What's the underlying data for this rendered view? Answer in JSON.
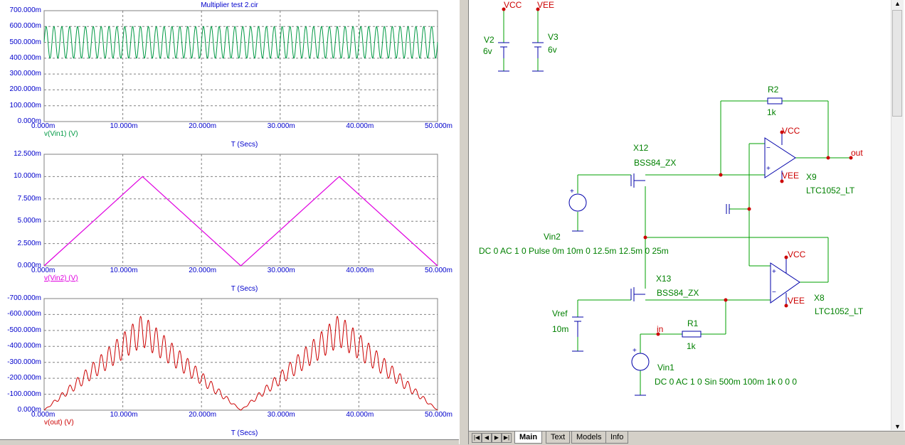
{
  "plot": {
    "title": "Multiplier test 2.cir",
    "x_ticks": [
      "0.000m",
      "10.000m",
      "20.000m",
      "30.000m",
      "40.000m",
      "50.000m"
    ],
    "x_label": "T (Secs)",
    "panels": [
      {
        "y_ticks": [
          "700.000m",
          "600.000m",
          "500.000m",
          "400.000m",
          "300.000m",
          "200.000m",
          "100.000m",
          "0.000m"
        ],
        "trace": "v(Vin1) (V)",
        "color": "#009944"
      },
      {
        "y_ticks": [
          "12.500m",
          "10.000m",
          "7.500m",
          "5.000m",
          "2.500m",
          "0.000m"
        ],
        "trace": "v(Vin2) (V)",
        "color": "#e000e0"
      },
      {
        "y_ticks": [
          "-700.000m",
          "-600.000m",
          "-500.000m",
          "-400.000m",
          "-300.000m",
          "-200.000m",
          "-100.000m",
          "0.000m"
        ],
        "trace": "v(out) (V)",
        "color": "#cc0000"
      }
    ]
  },
  "chart_data": [
    {
      "type": "line",
      "series": [
        {
          "name": "v(Vin1) (V)",
          "description_values": {
            "offset": 0.5,
            "amplitude": 0.1,
            "frequency_hz": 1000
          }
        }
      ],
      "xlim": [
        0,
        0.05
      ],
      "ylim": [
        0,
        0.7
      ],
      "xlabel": "T (Secs)",
      "ylabel": ""
    },
    {
      "type": "line",
      "series": [
        {
          "name": "v(Vin2) (V)",
          "x": [
            0,
            0.0125,
            0.025,
            0.0375,
            0.05
          ],
          "y": [
            0,
            0.01,
            0,
            0.01,
            0
          ]
        }
      ],
      "xlim": [
        0,
        0.05
      ],
      "ylim": [
        0,
        0.0125
      ],
      "xlabel": "T (Secs)",
      "ylabel": ""
    },
    {
      "type": "line",
      "series": [
        {
          "name": "v(out) (V)",
          "x": [
            0,
            0.0125,
            0.025,
            0.0375,
            0.05
          ],
          "y_envelope_center": [
            0,
            -0.5,
            0,
            -0.5,
            0
          ]
        }
      ],
      "xlim": [
        0,
        0.05
      ],
      "ylim": [
        -0.7,
        0
      ],
      "xlabel": "T (Secs)",
      "ylabel": ""
    }
  ],
  "schematic": {
    "vcc": "VCC",
    "vee": "VEE",
    "v2_name": "V2",
    "v2_value": "6v",
    "v3_name": "V3",
    "v3_value": "6v",
    "r2_name": "R2",
    "r2_value": "1k",
    "x12_name": "X12",
    "x12_model": "BSS84_ZX",
    "x9_name": "X9",
    "x9_model": "LTC1052_LT",
    "out_label": "out",
    "vin2_name": "Vin2",
    "vin2_spec": "DC 0 AC 1 0 Pulse 0m 10m 0 12.5m 12.5m 0 25m",
    "x13_name": "X13",
    "x13_model": "BSS84_ZX",
    "x8_name": "X8",
    "x8_model": "LTC1052_LT",
    "vref_name": "Vref",
    "vref_value": "10m",
    "in_label": "in",
    "r1_name": "R1",
    "r1_value": "1k",
    "vin1_name": "Vin1",
    "vin1_spec": "DC 0 AC 1 0 Sin 500m 100m 1k 0 0 0"
  },
  "tabs": [
    "Main",
    "Text",
    "Models",
    "Info"
  ],
  "colors": {
    "wire": "#00a000",
    "component": "#0000aa",
    "node": "#cc0000",
    "label": "#008000"
  }
}
